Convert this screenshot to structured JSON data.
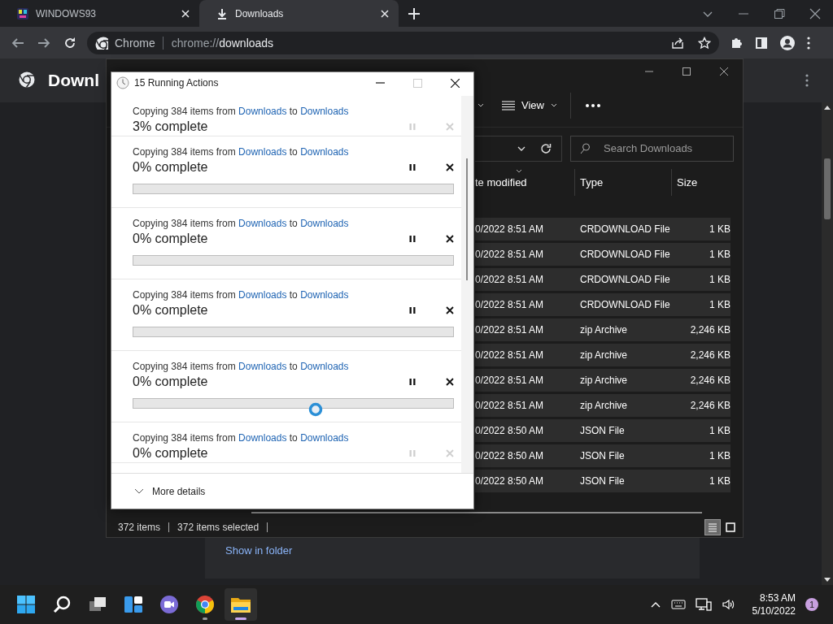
{
  "browser": {
    "tabs": [
      {
        "title": "WINDOWS93",
        "kind": "site",
        "selected": false
      },
      {
        "title": "Downloads",
        "kind": "download",
        "selected": true
      }
    ],
    "omnibox": {
      "site_label": "Chrome",
      "url_prefix": "chrome://",
      "url_host": "downloads"
    },
    "page": {
      "title": "Downl",
      "link": "Show in folder"
    }
  },
  "explorer": {
    "view_label": "View",
    "search": {
      "placeholder": "Search Downloads"
    },
    "columns": [
      "te modified",
      "Type",
      "Size"
    ],
    "rows": [
      {
        "date": "0/2022 8:51 AM",
        "type": "CRDOWNLOAD File",
        "size": "1 KB",
        "selected": true
      },
      {
        "date": "0/2022 8:51 AM",
        "type": "CRDOWNLOAD File",
        "size": "1 KB",
        "selected": true
      },
      {
        "date": "0/2022 8:51 AM",
        "type": "CRDOWNLOAD File",
        "size": "1 KB",
        "selected": true
      },
      {
        "date": "0/2022 8:51 AM",
        "type": "CRDOWNLOAD File",
        "size": "1 KB",
        "selected": true
      },
      {
        "date": "0/2022 8:51 AM",
        "type": "zip Archive",
        "size": "2,246 KB",
        "selected": true
      },
      {
        "date": "0/2022 8:51 AM",
        "type": "zip Archive",
        "size": "2,246 KB",
        "selected": true
      },
      {
        "date": "0/2022 8:51 AM",
        "type": "zip Archive",
        "size": "2,246 KB",
        "selected": true
      },
      {
        "date": "0/2022 8:51 AM",
        "type": "zip Archive",
        "size": "2,246 KB",
        "selected": true
      },
      {
        "date": "0/2022 8:50 AM",
        "type": "JSON File",
        "size": "1 KB",
        "selected": true
      },
      {
        "date": "0/2022 8:50 AM",
        "type": "JSON File",
        "size": "1 KB",
        "selected": true
      },
      {
        "date": "0/2022 8:50 AM",
        "type": "JSON File",
        "size": "1 KB",
        "selected": true
      }
    ],
    "status": {
      "count": "372 items",
      "selection": "372 items selected"
    },
    "views": [
      {
        "kind": "details",
        "selected": true
      },
      {
        "kind": "tiles",
        "selected": false
      }
    ]
  },
  "dialog": {
    "title": "15 Running Actions",
    "operations": [
      {
        "prefix": "Copying 384 items from ",
        "source": "Downloads",
        "joiner": " to ",
        "destination": "Downloads",
        "progress": "3% complete",
        "disabled": true
      },
      {
        "prefix": "Copying 384 items from ",
        "source": "Downloads",
        "joiner": " to ",
        "destination": "Downloads",
        "progress": "0% complete",
        "disabled": false,
        "level": 0
      },
      {
        "prefix": "Copying 384 items from ",
        "source": "Downloads",
        "joiner": " to ",
        "destination": "Downloads",
        "progress": "0% complete",
        "disabled": false,
        "level": 0
      },
      {
        "prefix": "Copying 384 items from ",
        "source": "Downloads",
        "joiner": " to ",
        "destination": "Downloads",
        "progress": "0% complete",
        "disabled": false,
        "level": 0
      },
      {
        "prefix": "Copying 384 items from ",
        "source": "Downloads",
        "joiner": " to ",
        "destination": "Downloads",
        "progress": "0% complete",
        "disabled": false,
        "level": 0
      },
      {
        "prefix": "Copying 384 items from ",
        "source": "Downloads",
        "joiner": " to ",
        "destination": "Downloads",
        "progress": "0% complete",
        "disabled": true
      }
    ],
    "more_details": "More details"
  },
  "taskbar": {
    "apps": [
      {
        "kind": "start",
        "running": false,
        "selected": false
      },
      {
        "kind": "search",
        "running": false,
        "selected": false
      },
      {
        "kind": "taskview",
        "running": false,
        "selected": false
      },
      {
        "kind": "widgets",
        "running": false,
        "selected": false
      },
      {
        "kind": "chat",
        "running": false,
        "selected": false
      },
      {
        "kind": "chrome",
        "running": true,
        "selected": false
      },
      {
        "kind": "explorer",
        "running": true,
        "selected": true
      }
    ],
    "time": "8:53 AM",
    "date": "5/10/2022",
    "notifications": "1"
  }
}
